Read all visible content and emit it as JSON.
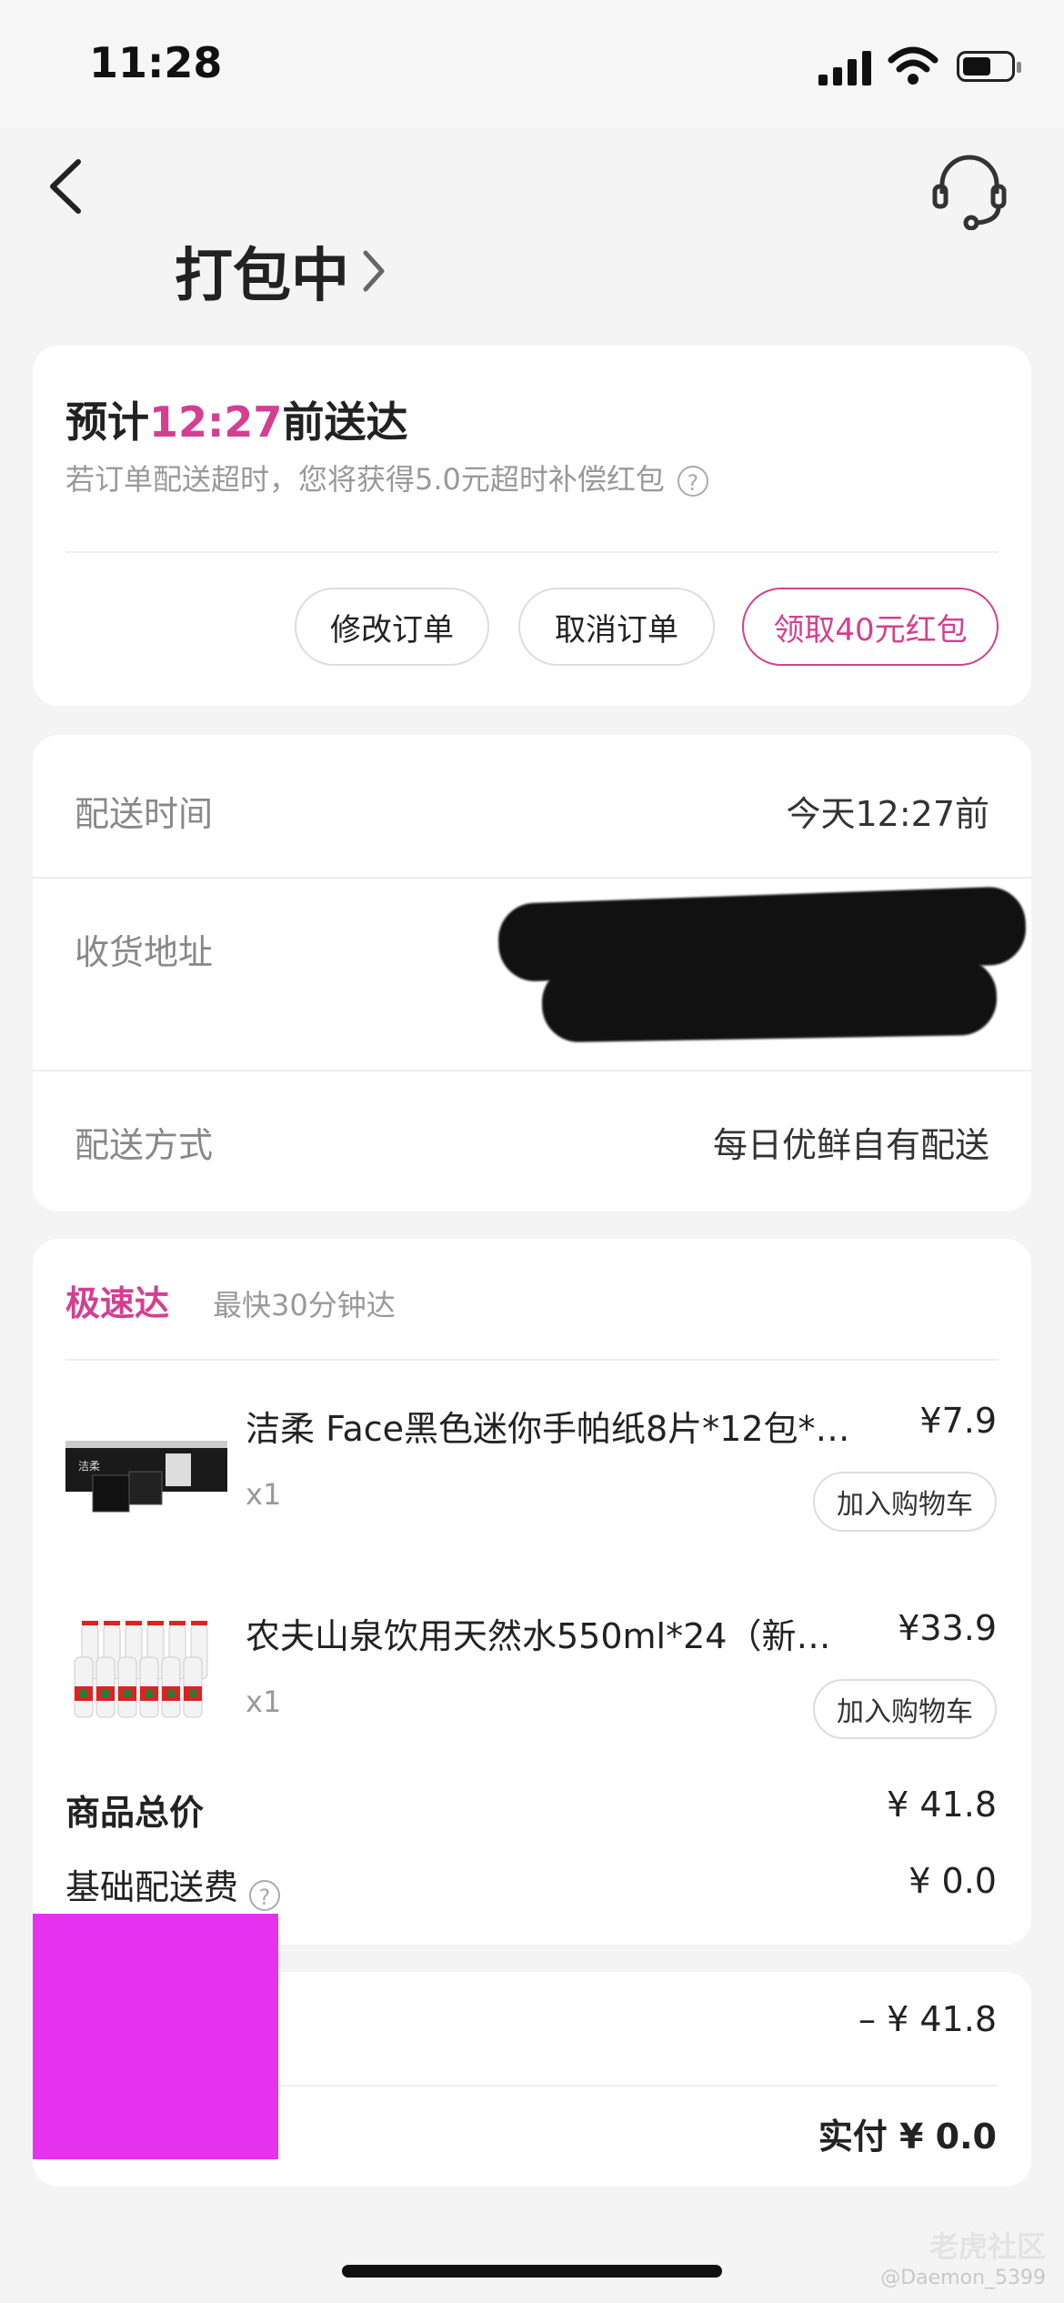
{
  "status_bar": {
    "time": "11:28"
  },
  "header": {
    "title": "打包中"
  },
  "eta_card": {
    "eta_prefix": "预计",
    "eta_time": "12:27",
    "eta_suffix": "前送达",
    "compensation_text": "若订单配送超时，您将获得5.0元超时补偿红包",
    "help_glyph": "?",
    "buttons": {
      "modify": "修改订单",
      "cancel": "取消订单",
      "coupon": "领取40元红包"
    },
    "accent_color": "#d43f91"
  },
  "delivery_card": {
    "time_label": "配送时间",
    "time_value": "今天12:27前",
    "address_label": "收货地址",
    "method_label": "配送方式",
    "method_value": "每日优鲜自有配送"
  },
  "items_card": {
    "speed_title": "极速达",
    "speed_sub": "最快30分钟达",
    "products": [
      {
        "name": "洁柔 Face黑色迷你手帕纸8片*12包*…",
        "price": "¥7.9",
        "qty": "x1",
        "add_label": "加入购物车",
        "thumb_icon": "tissue-pack-icon"
      },
      {
        "name": "农夫山泉饮用天然水550ml*24（新…",
        "price": "¥33.9",
        "qty": "x1",
        "add_label": "加入购物车",
        "thumb_icon": "water-bottles-icon"
      }
    ],
    "total_label": "商品总价",
    "total_value": "¥ 41.8",
    "fee_label": "基础配送费",
    "fee_value": "¥ 0.0"
  },
  "payment_card": {
    "discount_value": "– ¥ 41.8",
    "paid_text": "实付 ¥ 0.0"
  },
  "watermark": {
    "main": "老虎社区",
    "sub": "@Daemon_5399"
  }
}
